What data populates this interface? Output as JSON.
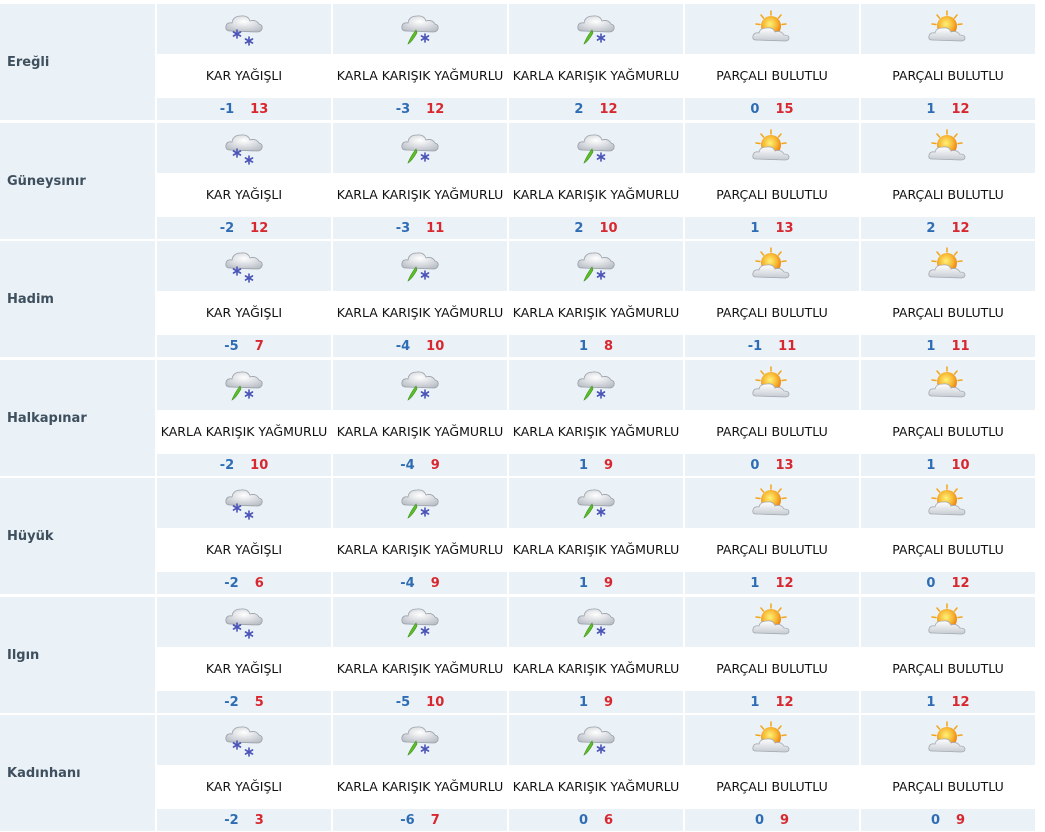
{
  "rows": [
    {
      "city": "Ereğli",
      "days": [
        {
          "icon": "snow-icon",
          "desc": "KAR YAĞIŞLI",
          "min": "-1",
          "max": "13"
        },
        {
          "icon": "sleet-icon",
          "desc": "KARLA KARIŞIK YAĞMURLU",
          "min": "-3",
          "max": "12"
        },
        {
          "icon": "sleet-icon",
          "desc": "KARLA KARIŞIK YAĞMURLU",
          "min": "2",
          "max": "12"
        },
        {
          "icon": "partly-cloudy-icon",
          "desc": "PARÇALI BULUTLU",
          "min": "0",
          "max": "15"
        },
        {
          "icon": "partly-cloudy-icon",
          "desc": "PARÇALI BULUTLU",
          "min": "1",
          "max": "12"
        }
      ]
    },
    {
      "city": "Güneysınır",
      "days": [
        {
          "icon": "snow-icon",
          "desc": "KAR YAĞIŞLI",
          "min": "-2",
          "max": "12"
        },
        {
          "icon": "sleet-icon",
          "desc": "KARLA KARIŞIK YAĞMURLU",
          "min": "-3",
          "max": "11"
        },
        {
          "icon": "sleet-icon",
          "desc": "KARLA KARIŞIK YAĞMURLU",
          "min": "2",
          "max": "10"
        },
        {
          "icon": "partly-cloudy-icon",
          "desc": "PARÇALI BULUTLU",
          "min": "1",
          "max": "13"
        },
        {
          "icon": "partly-cloudy-icon",
          "desc": "PARÇALI BULUTLU",
          "min": "2",
          "max": "12"
        }
      ]
    },
    {
      "city": "Hadim",
      "days": [
        {
          "icon": "snow-icon",
          "desc": "KAR YAĞIŞLI",
          "min": "-5",
          "max": "7"
        },
        {
          "icon": "sleet-icon",
          "desc": "KARLA KARIŞIK YAĞMURLU",
          "min": "-4",
          "max": "10"
        },
        {
          "icon": "sleet-icon",
          "desc": "KARLA KARIŞIK YAĞMURLU",
          "min": "1",
          "max": "8"
        },
        {
          "icon": "partly-cloudy-icon",
          "desc": "PARÇALI BULUTLU",
          "min": "-1",
          "max": "11"
        },
        {
          "icon": "partly-cloudy-icon",
          "desc": "PARÇALI BULUTLU",
          "min": "1",
          "max": "11"
        }
      ]
    },
    {
      "city": "Halkapınar",
      "days": [
        {
          "icon": "sleet-icon",
          "desc": "KARLA KARIŞIK YAĞMURLU",
          "min": "-2",
          "max": "10"
        },
        {
          "icon": "sleet-icon",
          "desc": "KARLA KARIŞIK YAĞMURLU",
          "min": "-4",
          "max": "9"
        },
        {
          "icon": "sleet-icon",
          "desc": "KARLA KARIŞIK YAĞMURLU",
          "min": "1",
          "max": "9"
        },
        {
          "icon": "partly-cloudy-icon",
          "desc": "PARÇALI BULUTLU",
          "min": "0",
          "max": "13"
        },
        {
          "icon": "partly-cloudy-icon",
          "desc": "PARÇALI BULUTLU",
          "min": "1",
          "max": "10"
        }
      ]
    },
    {
      "city": "Hüyük",
      "days": [
        {
          "icon": "snow-icon",
          "desc": "KAR YAĞIŞLI",
          "min": "-2",
          "max": "6"
        },
        {
          "icon": "sleet-icon",
          "desc": "KARLA KARIŞIK YAĞMURLU",
          "min": "-4",
          "max": "9"
        },
        {
          "icon": "sleet-icon",
          "desc": "KARLA KARIŞIK YAĞMURLU",
          "min": "1",
          "max": "9"
        },
        {
          "icon": "partly-cloudy-icon",
          "desc": "PARÇALI BULUTLU",
          "min": "1",
          "max": "12"
        },
        {
          "icon": "partly-cloudy-icon",
          "desc": "PARÇALI BULUTLU",
          "min": "0",
          "max": "12"
        }
      ]
    },
    {
      "city": "Ilgın",
      "days": [
        {
          "icon": "snow-icon",
          "desc": "KAR YAĞIŞLI",
          "min": "-2",
          "max": "5"
        },
        {
          "icon": "sleet-icon",
          "desc": "KARLA KARIŞIK YAĞMURLU",
          "min": "-5",
          "max": "10"
        },
        {
          "icon": "sleet-icon",
          "desc": "KARLA KARIŞIK YAĞMURLU",
          "min": "1",
          "max": "9"
        },
        {
          "icon": "partly-cloudy-icon",
          "desc": "PARÇALI BULUTLU",
          "min": "1",
          "max": "12"
        },
        {
          "icon": "partly-cloudy-icon",
          "desc": "PARÇALI BULUTLU",
          "min": "1",
          "max": "12"
        }
      ]
    },
    {
      "city": "Kadınhanı",
      "days": [
        {
          "icon": "snow-icon",
          "desc": "KAR YAĞIŞLI",
          "min": "-2",
          "max": "3"
        },
        {
          "icon": "sleet-icon",
          "desc": "KARLA KARIŞIK YAĞMURLU",
          "min": "-6",
          "max": "7"
        },
        {
          "icon": "sleet-icon",
          "desc": "KARLA KARIŞIK YAĞMURLU",
          "min": "0",
          "max": "6"
        },
        {
          "icon": "partly-cloudy-icon",
          "desc": "PARÇALI BULUTLU",
          "min": "0",
          "max": "9"
        },
        {
          "icon": "partly-cloudy-icon",
          "desc": "PARÇALI BULUTLU",
          "min": "0",
          "max": "9"
        }
      ]
    }
  ],
  "colors": {
    "band": "#eaf1f7",
    "city_text": "#3e4f5e",
    "min_temp": "#2e6db4",
    "max_temp": "#d8282f",
    "snowflake": "#4b55b8",
    "sleet_drop": "#5cbf2a",
    "sun": "#f2a51a"
  }
}
